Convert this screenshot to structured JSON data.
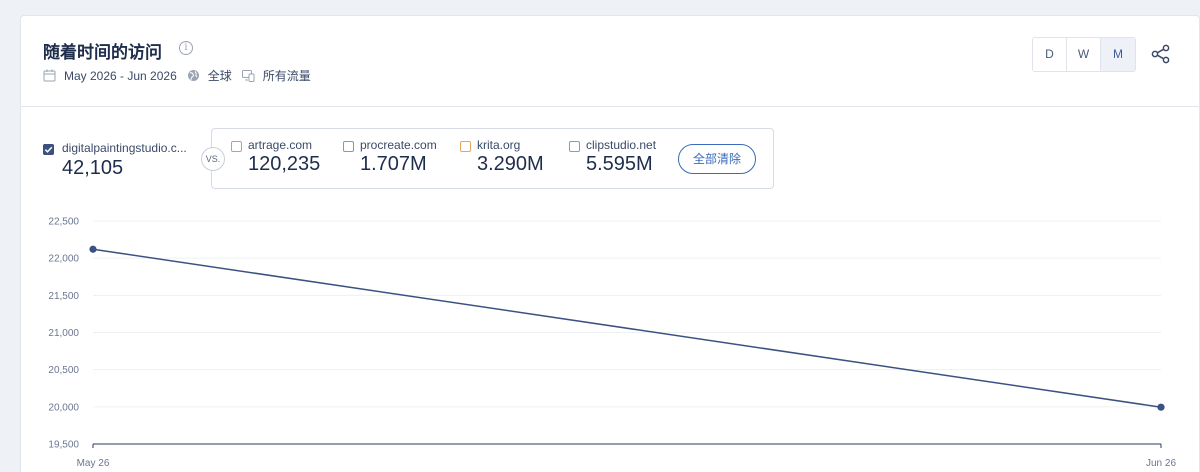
{
  "header": {
    "title": "随着时间的访问",
    "date_range": "May 2026 - Jun 2026",
    "region": "全球",
    "traffic": "所有流量"
  },
  "granularity": {
    "options": [
      "D",
      "W",
      "M"
    ],
    "selected": "M"
  },
  "main_site": {
    "name": "digitalpaintingstudio.c...",
    "value": "42,105",
    "color": "#3b5182"
  },
  "vs_label": "VS.",
  "competitors": [
    {
      "name": "artrage.com",
      "value": "120,235",
      "color": "#c9a06a"
    },
    {
      "name": "procreate.com",
      "value": "1.707M",
      "color": "#5aa8d6"
    },
    {
      "name": "krita.org",
      "value": "3.290M",
      "color": "#e3a85c"
    },
    {
      "name": "clipstudio.net",
      "value": "5.595M",
      "color": "#4fb3e0"
    }
  ],
  "clear_all_label": "全部清除",
  "chart_data": {
    "type": "line",
    "x": [
      "May 26",
      "Jun 26"
    ],
    "series": [
      {
        "name": "digitalpaintingstudio.c...",
        "values": [
          22120,
          19995
        ],
        "color": "#3b5182"
      }
    ],
    "yticks": [
      19500,
      20000,
      20500,
      21000,
      21500,
      22000,
      22500
    ],
    "ytick_labels": [
      "19,500",
      "20,000",
      "20,500",
      "21,000",
      "21,500",
      "22,000",
      "22,500"
    ],
    "ylim": [
      19500,
      22500
    ],
    "grid": true
  }
}
